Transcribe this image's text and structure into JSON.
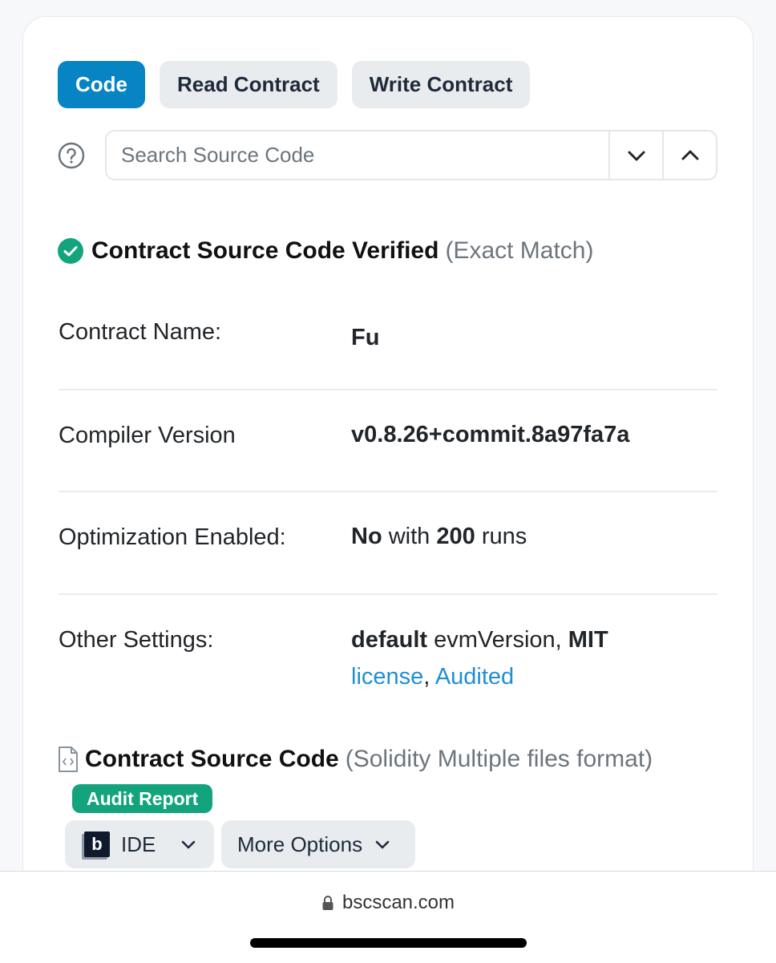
{
  "tabs": [
    {
      "label": "Code",
      "active": true
    },
    {
      "label": "Read Contract",
      "active": false
    },
    {
      "label": "Write Contract",
      "active": false
    }
  ],
  "search": {
    "placeholder": "Search Source Code"
  },
  "verified": {
    "title": "Contract Source Code Verified",
    "subtitle": "(Exact Match)"
  },
  "details": {
    "contract_name": {
      "label": "Contract Name:",
      "value": "Fu"
    },
    "compiler_version": {
      "label": "Compiler Version",
      "value": "v0.8.26+commit.8a97fa7a"
    },
    "optimization": {
      "label": "Optimization Enabled:",
      "enabled": "No",
      "with": "with",
      "runs_count": "200",
      "runs": "runs"
    },
    "other_settings": {
      "label": "Other Settings:",
      "evm_default": "default",
      "evm_text": "evmVersion,",
      "license_name": "MIT",
      "license_link": "license",
      "comma": ",",
      "audited_link": "Audited"
    }
  },
  "source": {
    "title": "Contract Source Code",
    "subtitle": "(Solidity Multiple files format)",
    "audit_badge": "Audit Report"
  },
  "actions": {
    "ide_logo": "b",
    "ide_label": "IDE",
    "more_options": "More Options"
  },
  "browser": {
    "url": "bscscan.com"
  },
  "colors": {
    "accent": "#0784c3",
    "success": "#13a47d",
    "link": "#1f8fd4"
  }
}
